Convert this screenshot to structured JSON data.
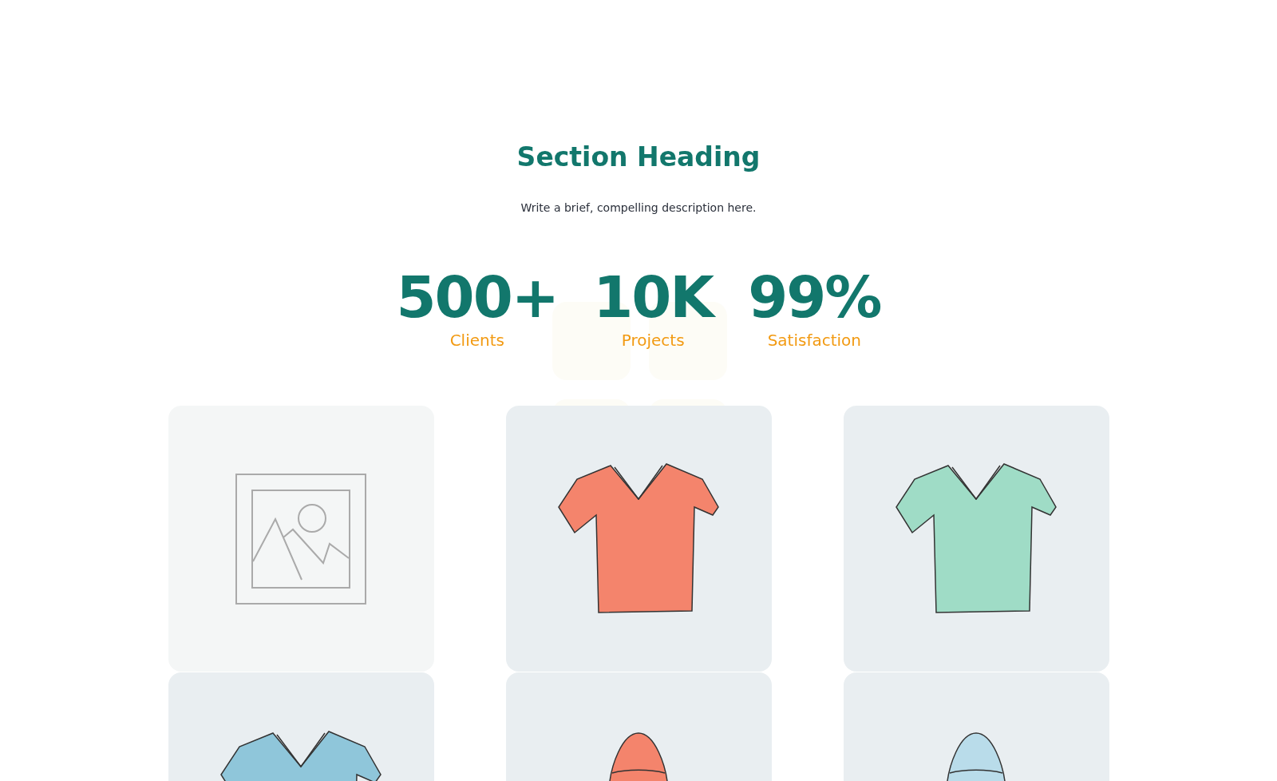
{
  "heading": "Section Heading",
  "description": "Write a brief, compelling description here.",
  "stats": [
    {
      "value": "500+",
      "label": "Clients"
    },
    {
      "value": "10K",
      "label": "Projects"
    },
    {
      "value": "99%",
      "label": "Satisfaction"
    }
  ],
  "cards": [
    {
      "kind": "placeholder"
    },
    {
      "kind": "tshirt",
      "color": "#f4846c"
    },
    {
      "kind": "tshirt",
      "color": "#9fdcc6"
    },
    {
      "kind": "tshirt",
      "color": "#8fc6da"
    },
    {
      "kind": "hat",
      "color": "#f4846c"
    },
    {
      "kind": "hat",
      "color": "#b9dcea"
    }
  ]
}
